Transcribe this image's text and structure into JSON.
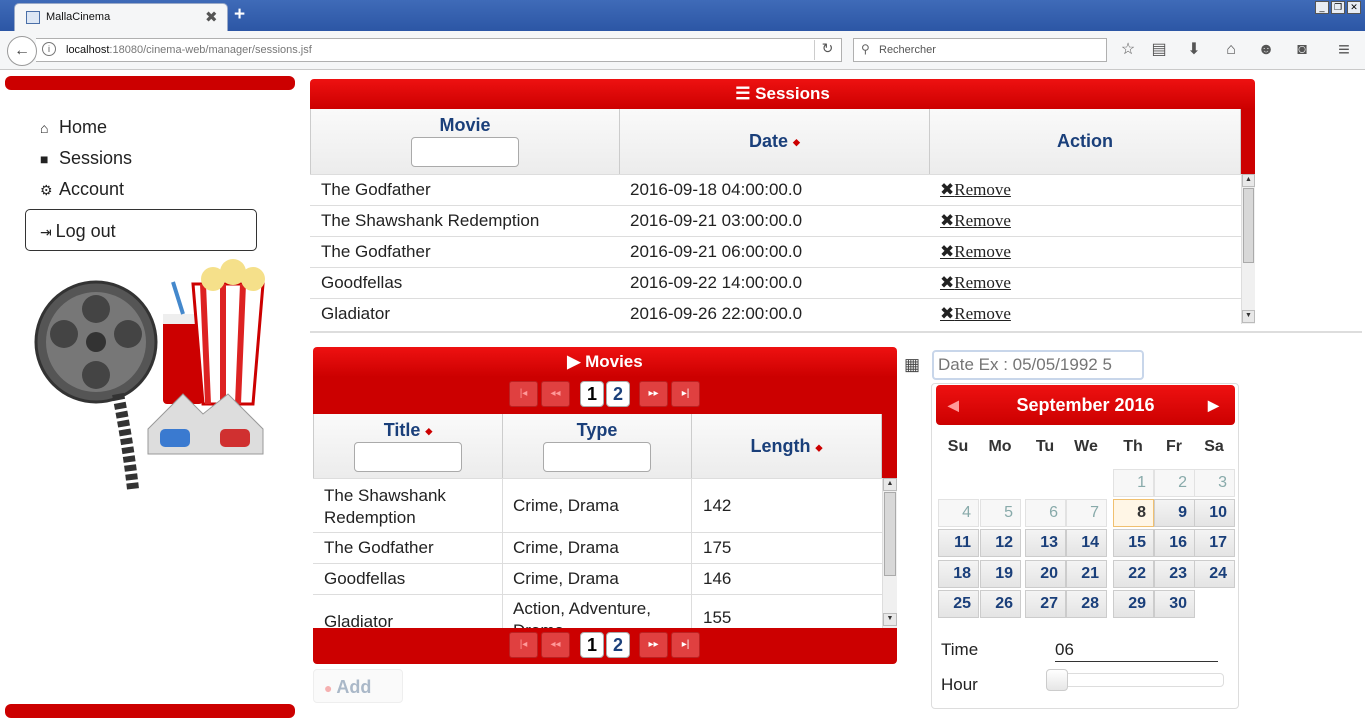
{
  "browser": {
    "tab_title": "MallaCinema",
    "tab_close": "✖",
    "new_tab": "+",
    "url_host": "localhost",
    "url_rest": ":18080/cinema-web/manager/sessions.jsf",
    "search_placeholder": "Rechercher"
  },
  "sidebar": {
    "items": [
      {
        "label": "Home",
        "icon": "home-icon"
      },
      {
        "label": "Sessions",
        "icon": "video-camera-icon"
      },
      {
        "label": "Account",
        "icon": "gear-icon"
      }
    ],
    "logout_label": "Log out"
  },
  "sessions": {
    "title": "Sessions",
    "columns": [
      "Movie",
      "Date",
      "Action"
    ],
    "remove_label": "Remove",
    "rows": [
      {
        "movie": "The Godfather",
        "date": "2016-09-18 04:00:00.0"
      },
      {
        "movie": "The Shawshank Redemption",
        "date": "2016-09-21 03:00:00.0"
      },
      {
        "movie": "The Godfather",
        "date": "2016-09-21 06:00:00.0"
      },
      {
        "movie": "Goodfellas",
        "date": "2016-09-22 14:00:00.0"
      },
      {
        "movie": "Gladiator",
        "date": "2016-09-26 22:00:00.0"
      }
    ]
  },
  "movies": {
    "title": "Movies",
    "columns": [
      "Title",
      "Type",
      "Length"
    ],
    "pages": [
      "1",
      "2"
    ],
    "rows": [
      {
        "title": "The Shawshank Redemption",
        "type": "Crime, Drama",
        "length": "142"
      },
      {
        "title": "The Godfather",
        "type": "Crime, Drama",
        "length": "175"
      },
      {
        "title": "Goodfellas",
        "type": "Crime, Drama",
        "length": "146"
      },
      {
        "title": "Gladiator",
        "type": "Action, Adventure, Drama",
        "length": "155"
      }
    ],
    "add_label": "Add"
  },
  "datepicker": {
    "placeholder": "Date Ex : 05/05/1992 5",
    "month_label": "September 2016",
    "weekdays": [
      "Su",
      "Mo",
      "Tu",
      "We",
      "Th",
      "Fr",
      "Sa"
    ],
    "time_label": "Time",
    "time_value": "06",
    "hour_label": "Hour",
    "hour_slider_value": 0
  },
  "colors": {
    "accent": "#cc0000",
    "header_text": "#1a3f7a"
  }
}
